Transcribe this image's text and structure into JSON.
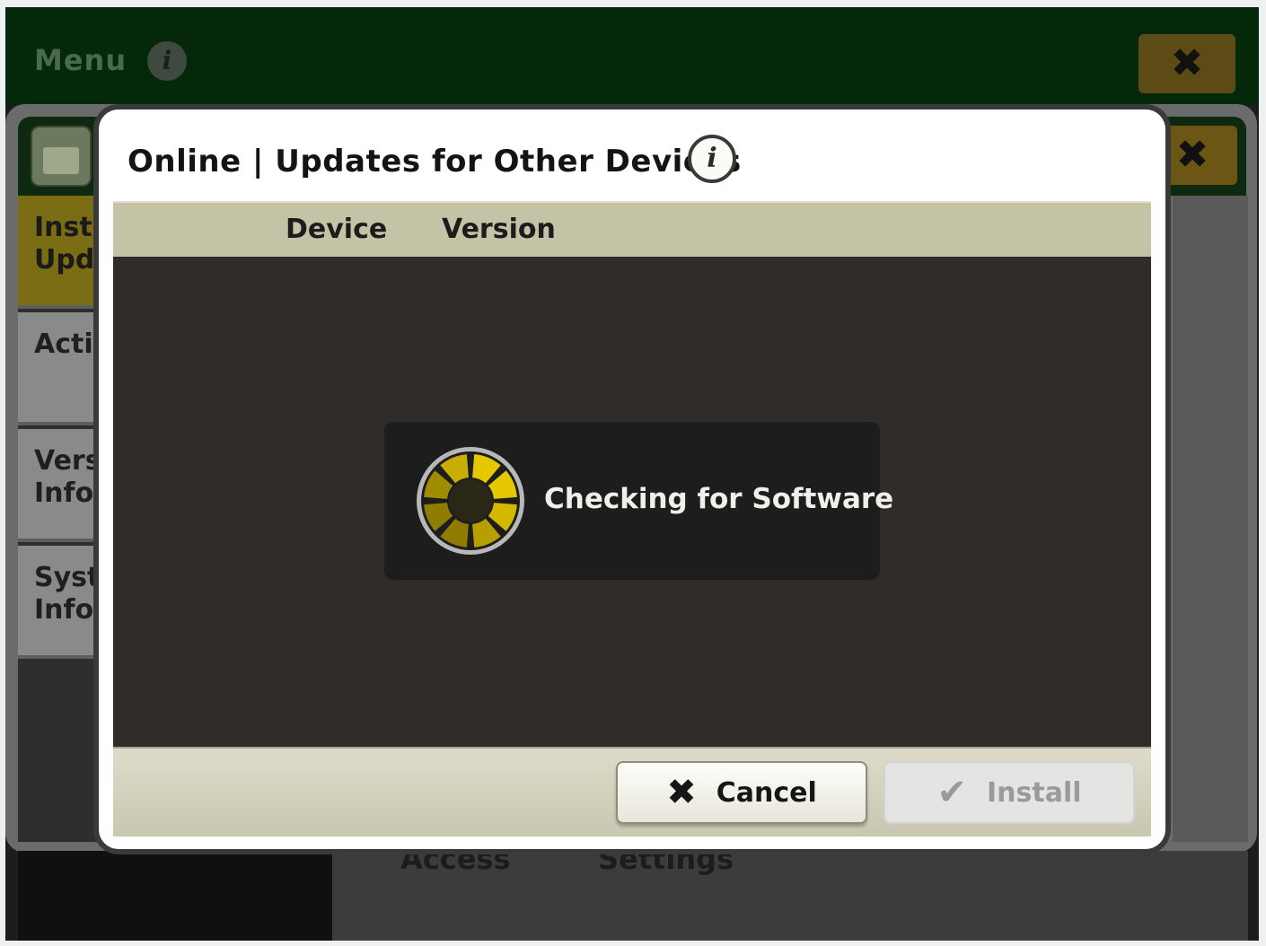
{
  "background": {
    "menu_title": "Menu",
    "menu_info_glyph": "i",
    "menu_close_glyph": "✖",
    "app_close_glyph": "✖",
    "sidebar": [
      {
        "label": "Insta\nUpda",
        "active": true
      },
      {
        "label": "Activ",
        "active": false
      },
      {
        "label": "Versi\nInfor",
        "active": false
      },
      {
        "label": "Syste\nInfor",
        "active": false
      }
    ],
    "bottom_labels": [
      "Access",
      "Settings"
    ]
  },
  "dialog": {
    "title": "Online | Updates for Other Devices",
    "info_glyph": "i",
    "columns": [
      "Device",
      "Version"
    ],
    "status_text": "Checking for Software",
    "buttons": {
      "cancel_label": "Cancel",
      "cancel_icon": "✖",
      "install_label": "Install",
      "install_icon": "✔"
    }
  },
  "colors": {
    "accent_yellow": "#e6c800",
    "dialog_header": "#c5c3a6",
    "dialog_body": "#2f2c2a",
    "menu_bar": "#06280a"
  },
  "icons": [
    "info-icon",
    "close-icon",
    "app-icon",
    "spinner-icon",
    "x-icon",
    "check-icon"
  ]
}
